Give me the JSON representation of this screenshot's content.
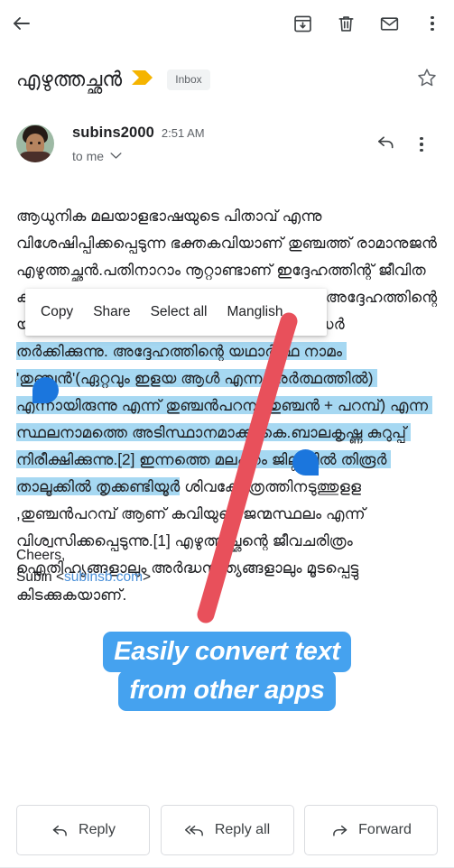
{
  "toolbar": {
    "back_icon": "back-arrow-icon",
    "archive_icon": "archive-icon",
    "delete_icon": "trash-icon",
    "unread_icon": "envelope-icon",
    "overflow_icon": "more-vertical-icon"
  },
  "subject": {
    "text": "എഴുത്തച്ഛൻ",
    "important_marker": "important-chevron-icon",
    "label": "Inbox",
    "star_icon": "star-outline-icon"
  },
  "sender": {
    "name": "subins2000",
    "time": "2:51 AM",
    "recipients": "to me",
    "expand_icon": "chevron-down-icon",
    "reply_icon": "reply-arrow-icon",
    "overflow_icon": "more-vertical-icon"
  },
  "body": {
    "pre_selection": "ആധുനിക മലയാളഭാഷയുടെ പിതാവ് എന്നു വിശേഷിപ്പിക്കപ്പെടുന്ന ഭക്തകവിയാണ് തുഞ്ചത്ത് രാമാനുജൻ എഴുത്തച്ഛൻ.പതിനാറാം നൂറ്റാണ്ടാണ് ഇദ്ദേഹത്തിന്റ് ജീവിത കാലഘട്ടം എന്ന് പൊതുവിൽ കരുതപ്പെടുന്നു.അദ്ദേഹത്തിന്റെ യഥാർത്ഥ നാമം എന്തായിരുന്നു എന്ന് വിദഗ്ദ്ധർ ",
    "selected": "തർക്കിക്കുന്നു. അദ്ദേഹത്തിന്റെ യഥാർത്ഥ നാമം 'തുഞ്ചൻ'(ഏറ്റവും ഇളയ ആൾ എന്ന അർത്ഥത്തിൽ) എന്നായിരുന്നു എന്ന് തുഞ്ചൻപറമ്പ്(തുഞ്ചൻ + പറമ്പ്) എന്ന സ്ഥലനാമത്തെ അടിസ്ഥാനമാക്കി കെ.ബാലകൃഷ്ണ കുറുപ്പ് നിരീക്ഷിക്കുന്നു.[2] ഇന്നത്തെ മലപ്പുറം ജില്ലയിൽ തിരൂർ താലൂക്കിൽ തൃക്കണ്ടിയൂർ",
    "post_selection": " ശിവക്ഷേത്രത്തിനടുത്തുളള ,തുഞ്ചൻപറമ്പ് ആണ് കവിയുടെ ജന്മസ്ഥലം എന്ന് വിശ്വസിക്കപ്പെടുന്നു.[1] എഴുത്തച്ഛന്റെ ജീവചരിത്രം ഐതിഹ്യങ്ങളാലും അർദ്ധസത്യങ്ങളാലും മൂടപ്പെട്ടു കിടക്കുകയാണ്."
  },
  "signature": {
    "line1": "Cheers,",
    "line2_prefix": "Subin <",
    "link": "subinsb.com",
    "line2_suffix": ">"
  },
  "context_menu": {
    "items": [
      {
        "label": "Copy"
      },
      {
        "label": "Share"
      },
      {
        "label": "Select all"
      },
      {
        "label": "Manglish"
      }
    ]
  },
  "annotation": {
    "arrow_color": "#e8505b",
    "caption_color": "#45a2ef",
    "caption_lines": [
      "Easily convert text",
      "from other apps"
    ]
  },
  "actions": {
    "reply": "Reply",
    "reply_all": "Reply all",
    "forward": "Forward"
  },
  "colors": {
    "selection_highlight": "#a6d8f2",
    "handle": "#1b76dd",
    "important_marker": "#f5b400",
    "link": "#4a90d9"
  }
}
